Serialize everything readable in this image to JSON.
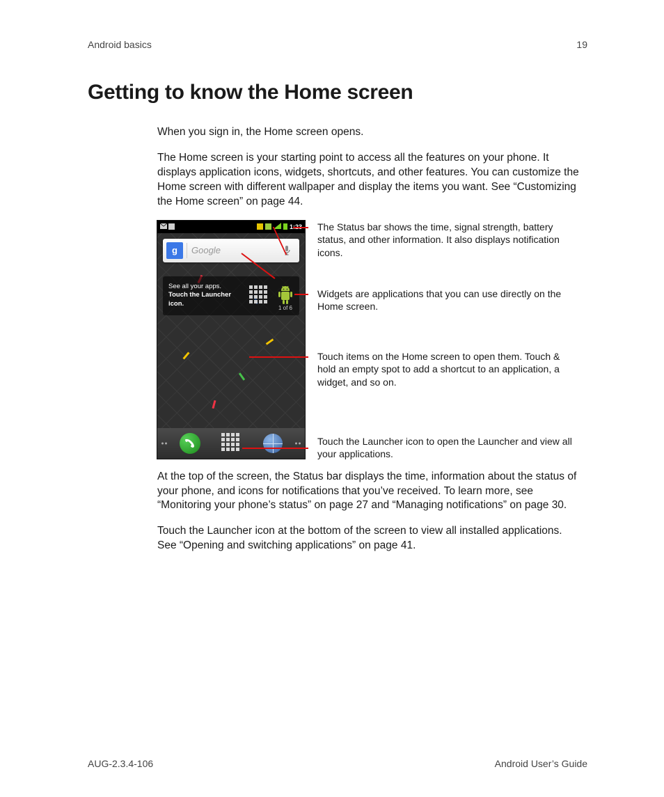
{
  "header": {
    "section": "Android basics",
    "page_number": "19"
  },
  "title": "Getting to know the Home screen",
  "paragraphs": {
    "p1": "When you sign in, the Home screen opens.",
    "p2": "The Home screen is your starting point to access all the features on your phone. It displays application icons, widgets, shortcuts, and other features. You can customize the Home screen with different wallpaper and display the items you want. See “Customizing the Home screen” on page 44.",
    "p3": "At the top of the screen, the Status bar displays the time, information about the status of your phone, and icons for notifications that you’ve received. To learn more, see “Monitoring your phone’s status” on page 27 and “Managing notifications” on page 30.",
    "p4": "Touch the Launcher icon at the bottom of the screen to view all installed applications. See “Opening and switching applications” on page 41."
  },
  "phone": {
    "statusbar_time": "1:23",
    "search_placeholder": "Google",
    "tips_line1": "See all your apps.",
    "tips_line2": "Touch the Launcher icon.",
    "tips_counter": "1 of 6",
    "google_g": "g"
  },
  "callouts": {
    "c1": "The Status bar shows the time, signal strength, battery status, and other information. It also displays notification icons.",
    "c2": "Widgets are applications that you can use directly on the Home screen.",
    "c3": "Touch items on the Home screen to open them. Touch & hold an empty spot to add a shortcut to an application, a widget, and so on.",
    "c4": "Touch the Launcher icon to open the Launcher and view all your applications."
  },
  "footer": {
    "doc_id": "AUG-2.3.4-106",
    "doc_title": "Android User’s Guide"
  }
}
